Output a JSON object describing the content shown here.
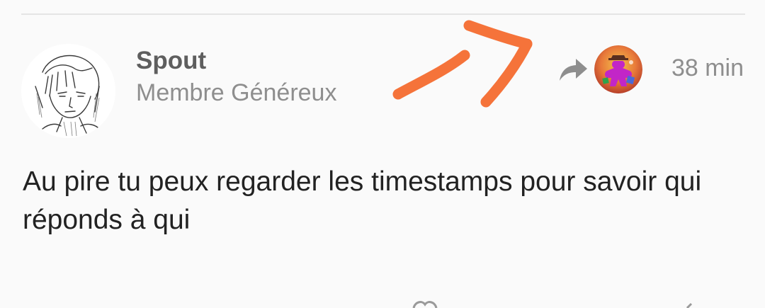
{
  "post": {
    "author": {
      "name": "Spout",
      "title": "Membre Généreux",
      "avatar_icon": "sketch-portrait-avatar"
    },
    "reply_to": {
      "icon": "reply-arrow-icon",
      "avatar_icon": "meeple-avatar"
    },
    "timestamp": "38 min",
    "body": "Au pire tu peux regarder les timestamps pour savoir qui réponds à qui"
  },
  "annotation": {
    "type": "hand-drawn-arrow",
    "color": "#f5733a"
  },
  "colors": {
    "background": "#fafafa",
    "divider": "#e4e4e4",
    "muted_text": "#8e8e8e",
    "username_text": "#5e5e5e",
    "body_text": "#222222"
  }
}
